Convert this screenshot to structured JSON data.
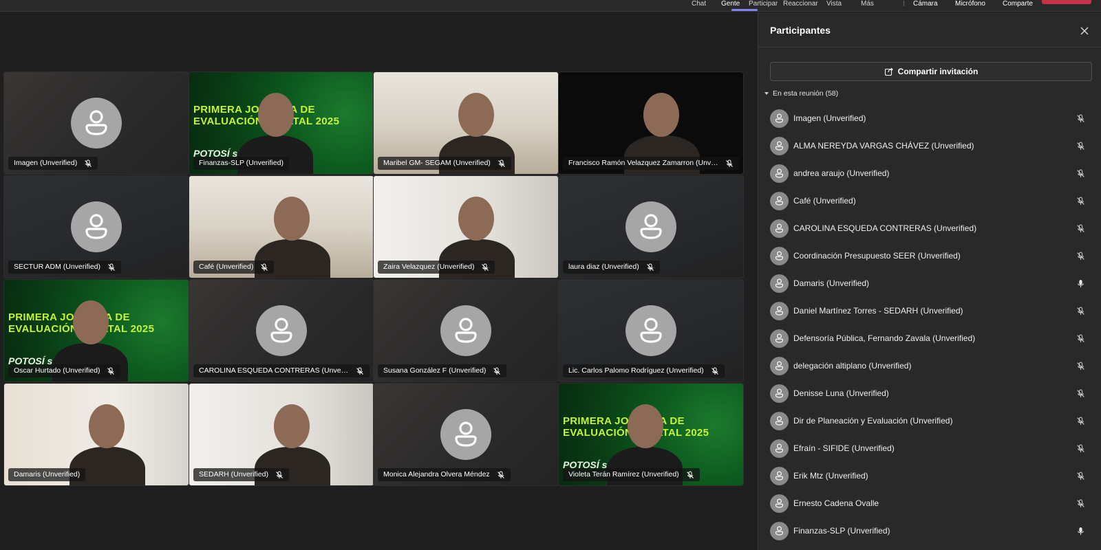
{
  "topbar": {
    "items": [
      "Chat",
      "Gente",
      "Participar",
      "Reaccionar",
      "Vista",
      "Más",
      "Cámara",
      "Micrófono",
      "Comparte"
    ],
    "active_index": 1
  },
  "grid": {
    "tiles": [
      {
        "name": "Imagen (Unverified)",
        "kind": "avatar",
        "muted": true
      },
      {
        "name": "Finanzas-SLP (Unverified)",
        "kind": "video",
        "muted": false
      },
      {
        "name": "Maribel GM- SEGAM (Unverified)",
        "kind": "video",
        "muted": true
      },
      {
        "name": "Francisco Ramón Velazquez Zamarron (Unve...",
        "kind": "video",
        "muted": true
      },
      {
        "name": "SECTUR ADM (Unverified)",
        "kind": "avatar",
        "muted": true
      },
      {
        "name": "Café (Unverified)",
        "kind": "video",
        "muted": true
      },
      {
        "name": "Zaira Velazquez (Unverified)",
        "kind": "video",
        "muted": true
      },
      {
        "name": "laura diaz (Unverified)",
        "kind": "avatar",
        "muted": true
      },
      {
        "name": "Oscar Hurtado (Unverified)",
        "kind": "video",
        "muted": true
      },
      {
        "name": "CAROLINA ESQUEDA CONTRERAS (Unverifi...",
        "kind": "avatar",
        "muted": true
      },
      {
        "name": "Susana González F (Unverified)",
        "kind": "avatar",
        "muted": true
      },
      {
        "name": "Lic. Carlos Palomo Rodríguez (Unverified)",
        "kind": "avatar",
        "muted": true
      },
      {
        "name": "Damaris (Unverified)",
        "kind": "video",
        "muted": false
      },
      {
        "name": "SEDARH (Unverified)",
        "kind": "video",
        "muted": true
      },
      {
        "name": "Monica Alejandra Olvera Méndez",
        "kind": "avatar",
        "muted": true
      },
      {
        "name": "Violeta Terán Ramírez (Unverified)",
        "kind": "video",
        "muted": true
      }
    ],
    "banner_line1": "PRIMERA JORNADA DE",
    "banner_line2": "EVALUACIÓN ESTATAL 2025",
    "banner_logo": "POTOSÍ sin límites"
  },
  "panel": {
    "title": "Participantes",
    "invite_label": "Compartir invitación",
    "section_label": "En esta reunión (58)",
    "participants": [
      {
        "name": "Imagen (Unverified)",
        "muted": true
      },
      {
        "name": "ALMA NEREYDA VARGAS CHÁVEZ (Unverified)",
        "muted": true
      },
      {
        "name": "andrea araujo (Unverified)",
        "muted": true
      },
      {
        "name": "Café (Unverified)",
        "muted": true
      },
      {
        "name": "CAROLINA ESQUEDA CONTRERAS (Unverified)",
        "muted": true
      },
      {
        "name": "Coordinación Presupuesto SEER (Unverified)",
        "muted": true
      },
      {
        "name": "Damaris (Unverified)",
        "muted": false
      },
      {
        "name": "Daniel Martínez Torres - SEDARH (Unverified)",
        "muted": true
      },
      {
        "name": "Defensoría Pública, Fernando Zavala (Unverified)",
        "muted": true
      },
      {
        "name": "delegación altiplano (Unverified)",
        "muted": true
      },
      {
        "name": "Denisse Luna (Unverified)",
        "muted": true
      },
      {
        "name": "Dir de Planeación y Evaluación (Unverified)",
        "muted": true
      },
      {
        "name": "Efraín - SIFIDE (Unverified)",
        "muted": true
      },
      {
        "name": "Erik Mtz (Unverified)",
        "muted": true
      },
      {
        "name": "Ernesto Cadena Ovalle",
        "muted": true
      },
      {
        "name": "Finanzas-SLP (Unverified)",
        "muted": false
      }
    ]
  },
  "colors": {
    "accent": "#7f85f5",
    "leave": "#c4314b",
    "panel_bg": "#292929",
    "stage_bg": "#1f1f1f"
  }
}
